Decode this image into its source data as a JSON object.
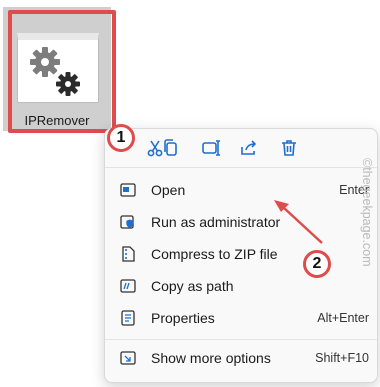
{
  "file": {
    "name": "IPRemover",
    "icon": "gears-icon"
  },
  "quick_actions": [
    {
      "icon": "cut-icon"
    },
    {
      "icon": "copy-icon"
    },
    {
      "icon": "rename-icon"
    },
    {
      "icon": "share-icon"
    },
    {
      "icon": "delete-icon"
    }
  ],
  "menu": {
    "items": [
      {
        "label": "Open",
        "shortcut": "Enter",
        "icon": "open-icon"
      },
      {
        "label": "Run as administrator",
        "shortcut": "",
        "icon": "shield-icon"
      },
      {
        "label": "Compress to ZIP file",
        "shortcut": "",
        "icon": "zip-icon"
      },
      {
        "label": "Copy as path",
        "shortcut": "",
        "icon": "path-icon"
      },
      {
        "label": "Properties",
        "shortcut": "Alt+Enter",
        "icon": "properties-icon"
      },
      {
        "label": "Show more options",
        "shortcut": "Shift+F10",
        "icon": "more-options-icon"
      }
    ]
  },
  "annotations": {
    "step1": "1",
    "step2": "2"
  },
  "watermark": "©thegeekpage.com",
  "colors": {
    "annotation_red": "#e04b4b",
    "accent_blue": "#1f6fcf"
  }
}
